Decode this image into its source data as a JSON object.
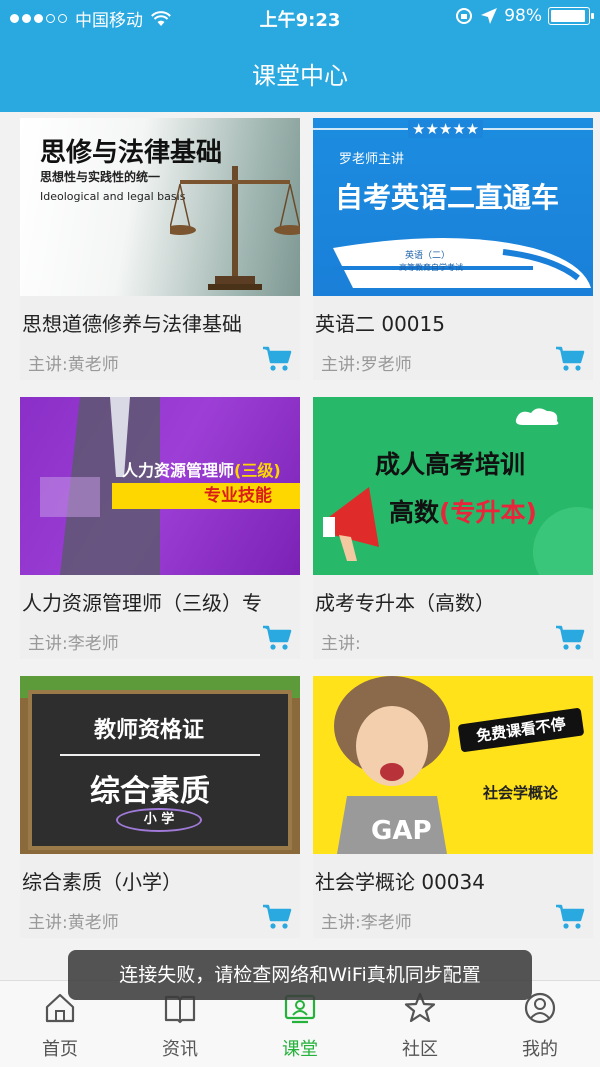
{
  "status_bar": {
    "carrier": "中国移动",
    "time": "上午9:23",
    "battery": "98%",
    "battery_level": 0.98
  },
  "header": {
    "title": "课堂中心"
  },
  "courses": [
    {
      "name": "思想道德修养与法律基础",
      "teacher": "主讲:黄老师",
      "thumb": {
        "title": "思修与法律基础",
        "subtitle": "思想性与实践性的统一",
        "english": "Ideological and legal basis"
      }
    },
    {
      "name": "英语二 00015",
      "teacher": "主讲:罗老师",
      "thumb": {
        "stars": "★★★★★",
        "teacher_line": "罗老师主讲",
        "title": "自考英语二直通车",
        "train_label": "英语（二）",
        "train_sub": "高等教育自学考试"
      }
    },
    {
      "name": "人力资源管理师（三级）专",
      "teacher": "主讲:李老师",
      "thumb": {
        "title": "人力资源管理师",
        "level": "(三级)",
        "banner": "专业技能"
      }
    },
    {
      "name": "成考专升本（高数）",
      "teacher": "主讲:",
      "thumb": {
        "title": "成人高考培训",
        "sub_a": "高数",
        "sub_b": "(专升本)"
      }
    },
    {
      "name": "综合素质（小学）",
      "teacher": "主讲:黄老师",
      "thumb": {
        "line1": "教师资格证",
        "line2": "综合素质",
        "badge": "小 学"
      }
    },
    {
      "name": "社会学概论 00034",
      "teacher": "主讲:李老师",
      "thumb": {
        "banner": "免费课看不停",
        "subject": "社会学概论",
        "shirt": "GAP"
      }
    }
  ],
  "toast": "连接失败，请检查网络和WiFi真机同步配置",
  "tabs": [
    {
      "label": "首页",
      "icon": "home-icon",
      "active": false
    },
    {
      "label": "资讯",
      "icon": "book-icon",
      "active": false
    },
    {
      "label": "课堂",
      "icon": "classroom-icon",
      "active": true
    },
    {
      "label": "社区",
      "icon": "star-icon",
      "active": false
    },
    {
      "label": "我的",
      "icon": "user-icon",
      "active": false
    }
  ],
  "colors": {
    "primary": "#2aa9e0",
    "active_tab": "#25b23b",
    "cart": "#2aa9e0"
  }
}
